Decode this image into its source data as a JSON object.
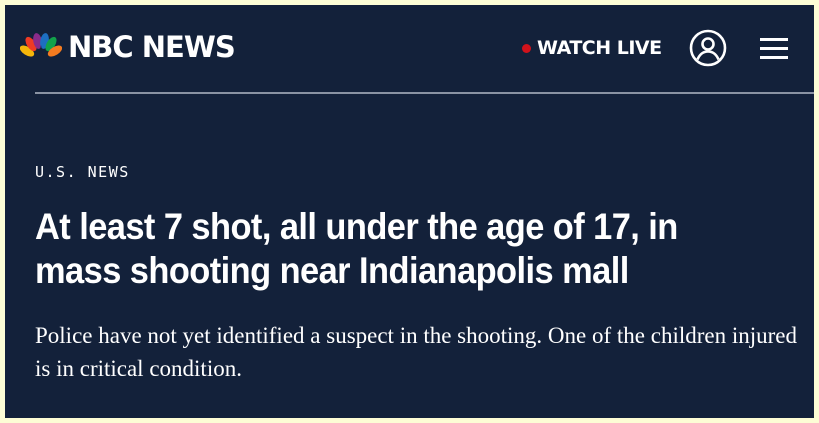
{
  "header": {
    "logo_text": "NBC NEWS",
    "watch_live_label": "WATCH LIVE"
  },
  "icons": {
    "logo": "nbc-peacock-icon",
    "live": "live-dot-icon",
    "account": "user-account-icon",
    "menu": "hamburger-menu-icon"
  },
  "colors": {
    "background": "#13213a",
    "page_border": "#fdfdd5",
    "text": "#ffffff",
    "live_dot": "#d1121b",
    "divider": "#8a93a3"
  },
  "article": {
    "section": "U.S. NEWS",
    "headline": "At least 7 shot, all under the age of 17, in mass shooting near Indianapolis mall",
    "subheadline": "Police have not yet identified a suspect in the shooting. One of the children injured is in critical condition."
  }
}
